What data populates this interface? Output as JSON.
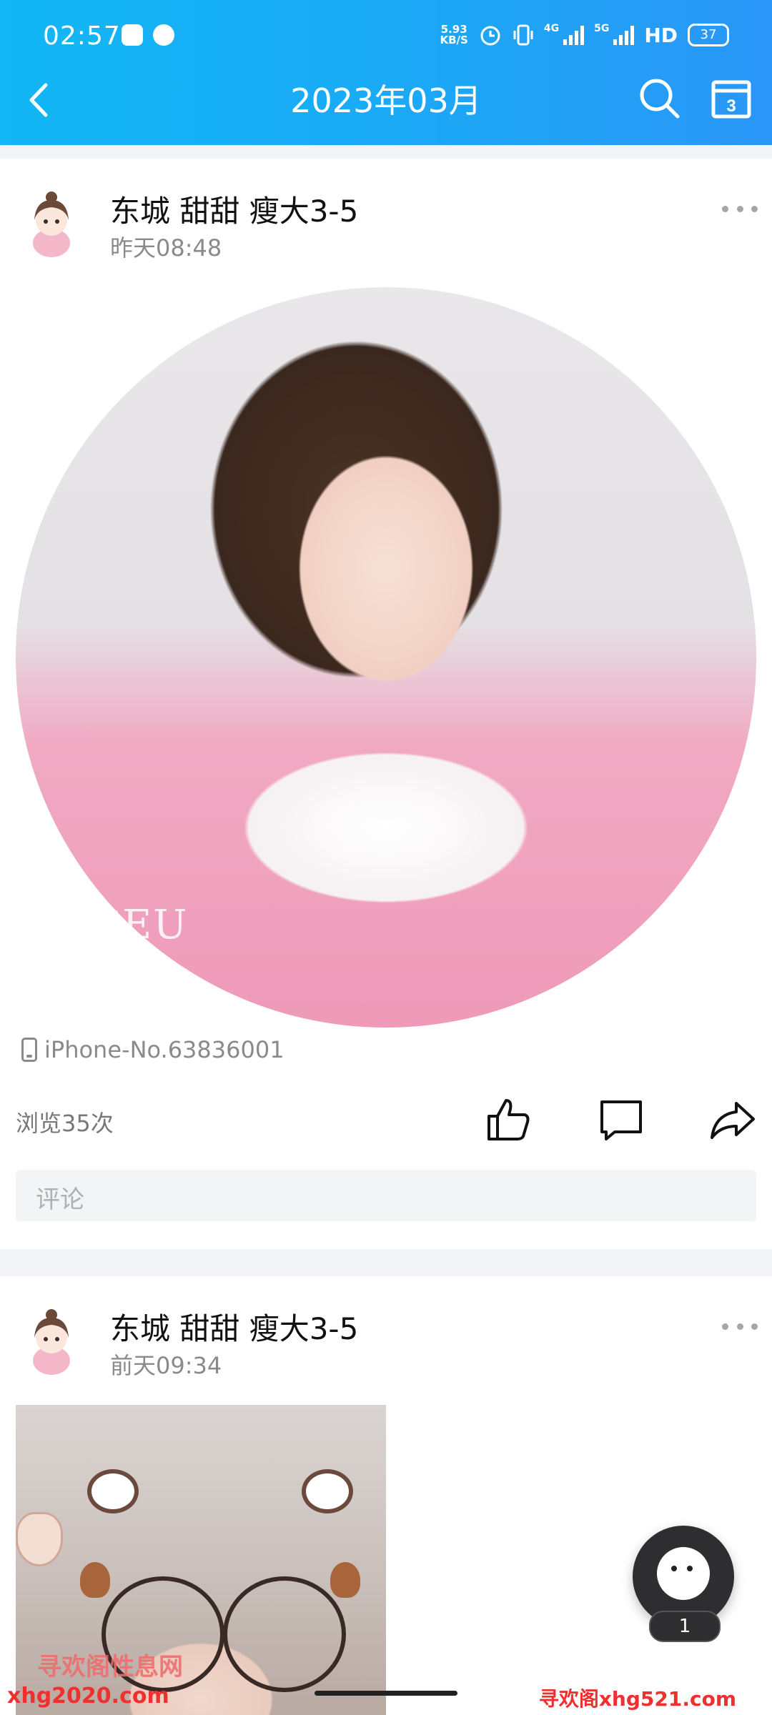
{
  "status_bar": {
    "time": "02:57",
    "net_speed_value": "5.93",
    "net_speed_unit": "KB/S",
    "network_4g": "4G",
    "network_5g": "5G",
    "hd": "HD",
    "battery": "37"
  },
  "nav": {
    "title": "2023年03月"
  },
  "posts": [
    {
      "author": "东城 甜甜 瘦大3-5",
      "time": "昨天08:48",
      "photo_watermark": "FACEU",
      "device": "iPhone-No.63836001",
      "views": "浏览35次",
      "comment_placeholder": "评论"
    },
    {
      "author": "东城 甜甜 瘦大3-5",
      "time": "前天09:34"
    }
  ],
  "fab": {
    "badge": "1"
  },
  "watermarks": {
    "left_cn": "寻欢阁性息网",
    "left_url": "xhg2020.com",
    "right": "寻欢阁xhg521.com"
  },
  "colors": {
    "header_start": "#12b7f5",
    "header_end": "#2a96f7"
  }
}
